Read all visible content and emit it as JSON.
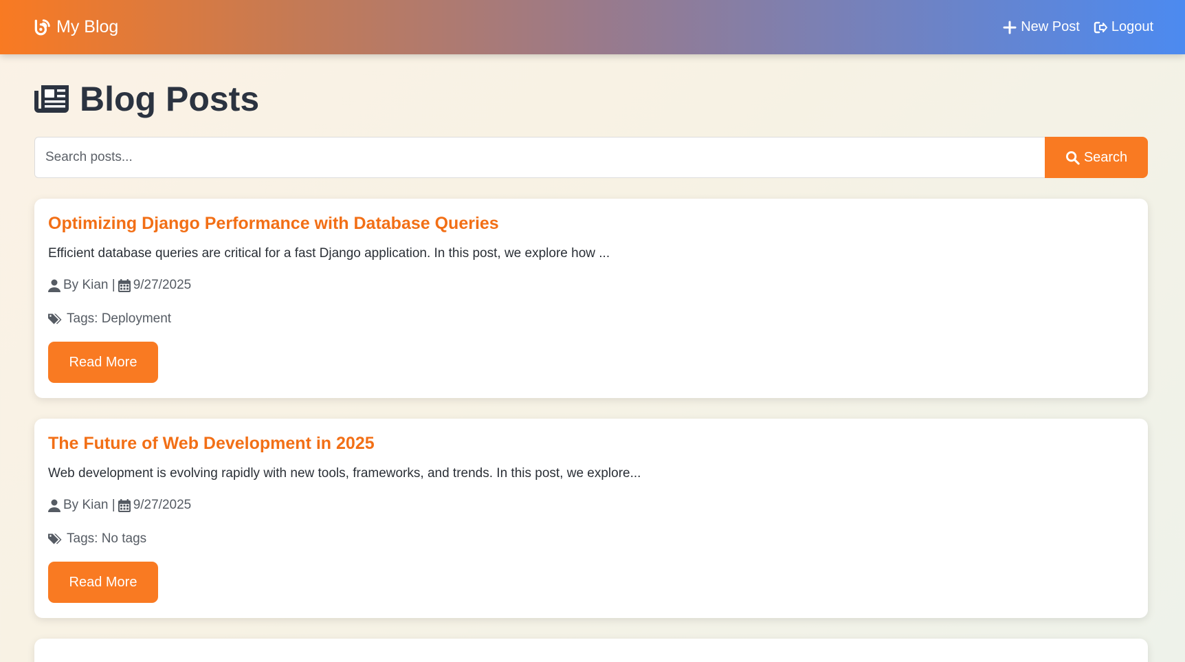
{
  "navbar": {
    "brand": "My Blog",
    "new_post": "New Post",
    "logout": "Logout"
  },
  "page": {
    "title": "Blog Posts"
  },
  "search": {
    "placeholder": "Search posts...",
    "button": "Search"
  },
  "posts": [
    {
      "title": "Optimizing Django Performance with Database Queries",
      "excerpt": "Efficient database queries are critical for a fast Django application. In this post, we explore how ...",
      "author": "By Kian |",
      "date": "9/27/2025",
      "tags": "Tags: Deployment",
      "button": "Read More"
    },
    {
      "title": "The Future of Web Development in 2025",
      "excerpt": "Web development is evolving rapidly with new tools, frameworks, and trends. In this post, we explore...",
      "author": "By Kian |",
      "date": "9/27/2025",
      "tags": "Tags: No tags",
      "button": "Read More"
    }
  ],
  "colors": {
    "accent": "#f97a22",
    "title": "#f26f16",
    "nav_start": "#f97a22",
    "nav_end": "#4c8af0"
  }
}
